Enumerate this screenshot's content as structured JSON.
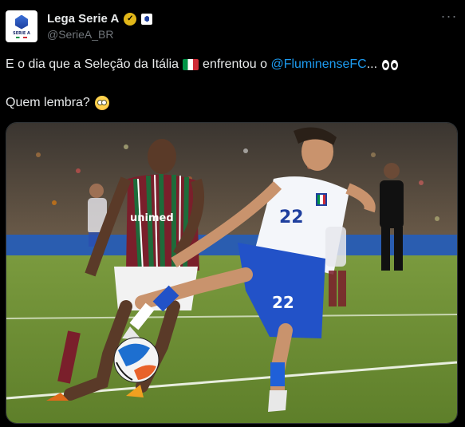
{
  "author": {
    "display_name": "Lega Serie A",
    "handle": "@SerieA_BR",
    "avatar_text": "SERIE A",
    "verified": true,
    "badge_color": "#e2b719"
  },
  "menu": {
    "more_label": "···"
  },
  "tweet": {
    "text_before_flag": "E o dia que a Seleção da Itália",
    "text_after_flag": "enfrentou o",
    "mention": "@FluminenseFC",
    "ellipsis": "...",
    "line2": "Quem lembra?",
    "mention_color": "#1d9bf0"
  },
  "media": {
    "jersey_numbers": [
      "22",
      "22"
    ],
    "sponsor_text": "unimed"
  }
}
